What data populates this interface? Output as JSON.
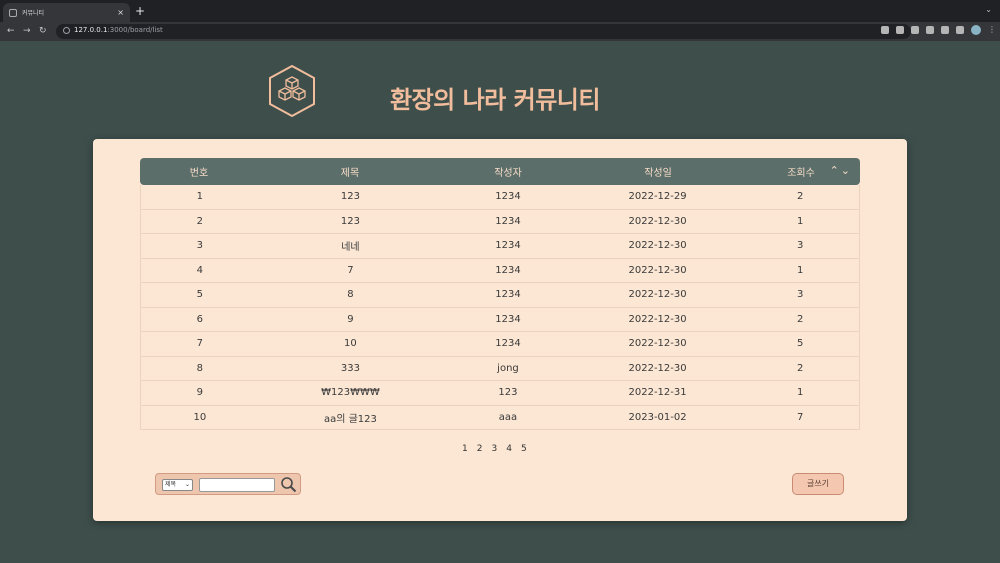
{
  "browser": {
    "tab_title": "커뮤니티",
    "tab_close": "×",
    "new_tab": "+",
    "url_host": "127.0.0.1",
    "url_path": ":3000/board/list"
  },
  "site": {
    "title": "환장의 나라 커뮤니티",
    "logo_icon": "hexagon-cubes-logo"
  },
  "table": {
    "headers": [
      "번호",
      "제목",
      "작성자",
      "작성일",
      "조회수"
    ],
    "sort_icons": "≈ ≈",
    "rows": [
      [
        "1",
        "123",
        "1234",
        "2022-12-29",
        "2"
      ],
      [
        "2",
        "123",
        "1234",
        "2022-12-30",
        "1"
      ],
      [
        "3",
        "네네",
        "1234",
        "2022-12-30",
        "3"
      ],
      [
        "4",
        "7",
        "1234",
        "2022-12-30",
        "1"
      ],
      [
        "5",
        "8",
        "1234",
        "2022-12-30",
        "3"
      ],
      [
        "6",
        "9",
        "1234",
        "2022-12-30",
        "2"
      ],
      [
        "7",
        "10",
        "1234",
        "2022-12-30",
        "5"
      ],
      [
        "8",
        "333",
        "jong",
        "2022-12-30",
        "2"
      ],
      [
        "9",
        "₩123₩₩₩",
        "123",
        "2022-12-31",
        "1"
      ],
      [
        "10",
        "aa의 글123",
        "aaa",
        "2023-01-02",
        "7"
      ]
    ]
  },
  "pagination": [
    "1",
    "2",
    "3",
    "4",
    "5"
  ],
  "search": {
    "select_value": "제목",
    "input_value": "",
    "icon": "search-icon"
  },
  "write_button": "글쓰기",
  "colors": {
    "background": "#3d4e4b",
    "panel": "#fbe7d4",
    "header": "#5b6e6a",
    "accent": "#f1bd9c"
  }
}
